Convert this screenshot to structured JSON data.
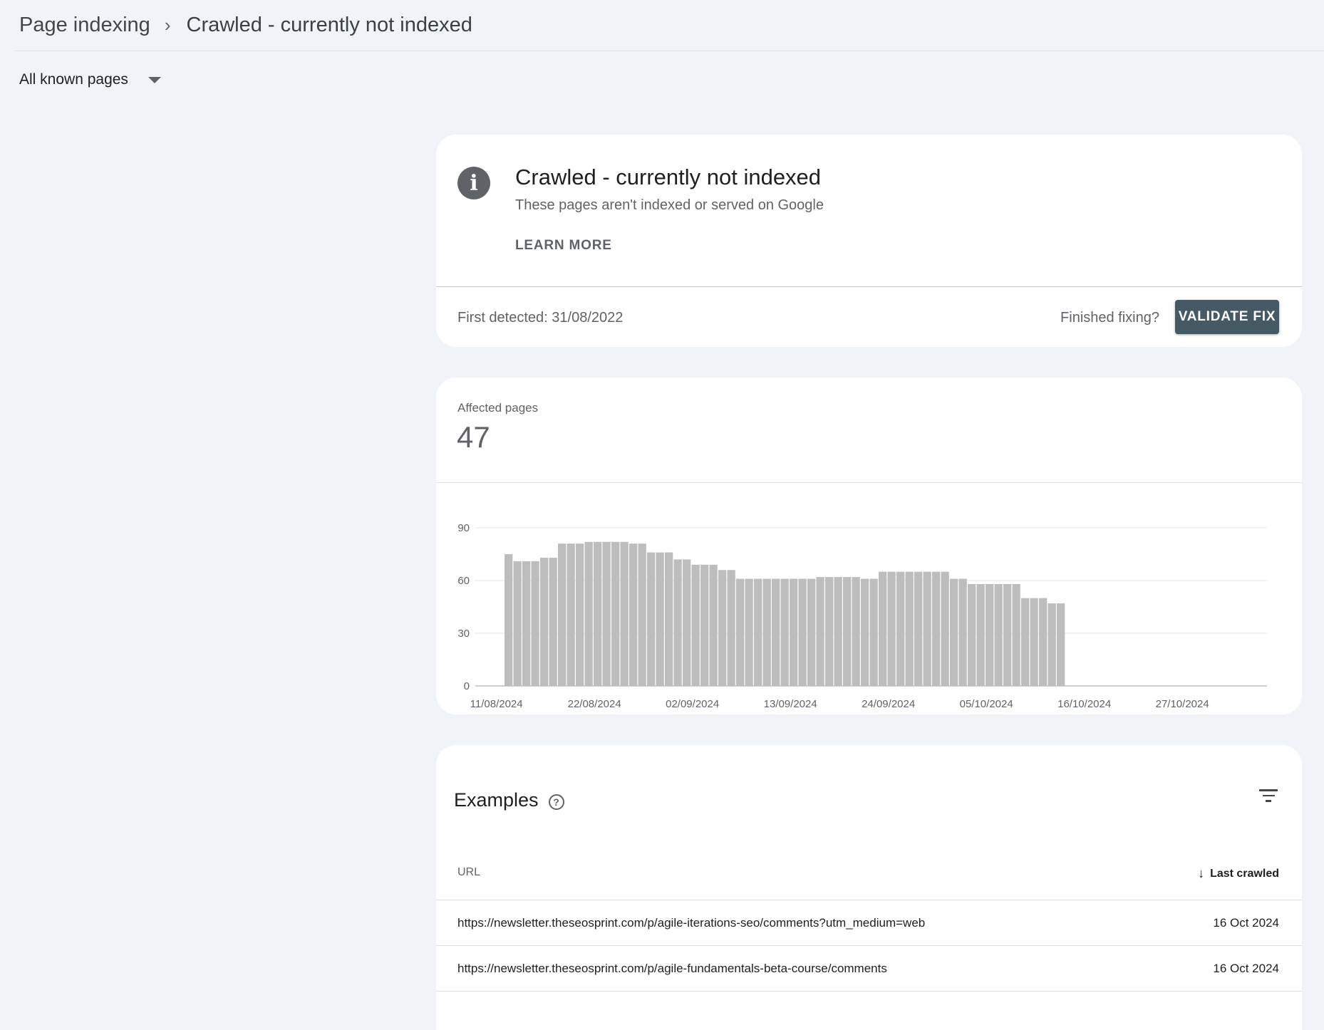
{
  "breadcrumb": {
    "parent": "Page indexing",
    "separator": "›",
    "current": "Crawled - currently not indexed"
  },
  "filter": {
    "selected": "All known pages"
  },
  "info_card": {
    "icon": "info-icon",
    "title": "Crawled - currently not indexed",
    "subtitle": "These pages aren't indexed or served on Google",
    "learn_more": "LEARN MORE",
    "first_detected": "First detected: 31/08/2022",
    "finished_fixing": "Finished fixing?",
    "validate_fix": "VALIDATE FIX",
    "accent_color": "#455a64"
  },
  "affected": {
    "label": "Affected pages",
    "value": "47"
  },
  "chart_data": {
    "type": "bar",
    "bar_color": "#bdbdbd",
    "ylim": [
      0,
      90
    ],
    "yticks": [
      0,
      30,
      60,
      90
    ],
    "xtick_labels": [
      "11/08/2024",
      "22/08/2024",
      "02/09/2024",
      "13/09/2024",
      "24/09/2024",
      "05/10/2024",
      "16/10/2024",
      "27/10/2024"
    ],
    "xtick_start_index": 0,
    "xtick_every": 11,
    "values": [
      75,
      71,
      71,
      71,
      73,
      73,
      81,
      81,
      81,
      82,
      82,
      82,
      82,
      82,
      81,
      81,
      76,
      76,
      76,
      72,
      72,
      69,
      69,
      69,
      66,
      66,
      61,
      61,
      61,
      61,
      61,
      61,
      61,
      61,
      61,
      62,
      62,
      62,
      62,
      62,
      61,
      61,
      65,
      65,
      65,
      65,
      65,
      65,
      65,
      65,
      61,
      61,
      58,
      58,
      58,
      58,
      58,
      58,
      50,
      50,
      50,
      47,
      47
    ]
  },
  "examples": {
    "title": "Examples",
    "help_icon": "help-circle-icon",
    "filter_icon": "filter-list-icon",
    "columns": {
      "url": "URL",
      "last_crawled": "Last crawled",
      "sort_icon": "arrow-down-icon"
    },
    "rows": [
      {
        "url": "https://newsletter.theseosprint.com/p/agile-iterations-seo/comments?utm_medium=web",
        "last_crawled": "16 Oct 2024"
      },
      {
        "url": "https://newsletter.theseosprint.com/p/agile-fundamentals-beta-course/comments",
        "last_crawled": "16 Oct 2024"
      },
      {
        "url": "",
        "last_crawled": ""
      }
    ]
  }
}
